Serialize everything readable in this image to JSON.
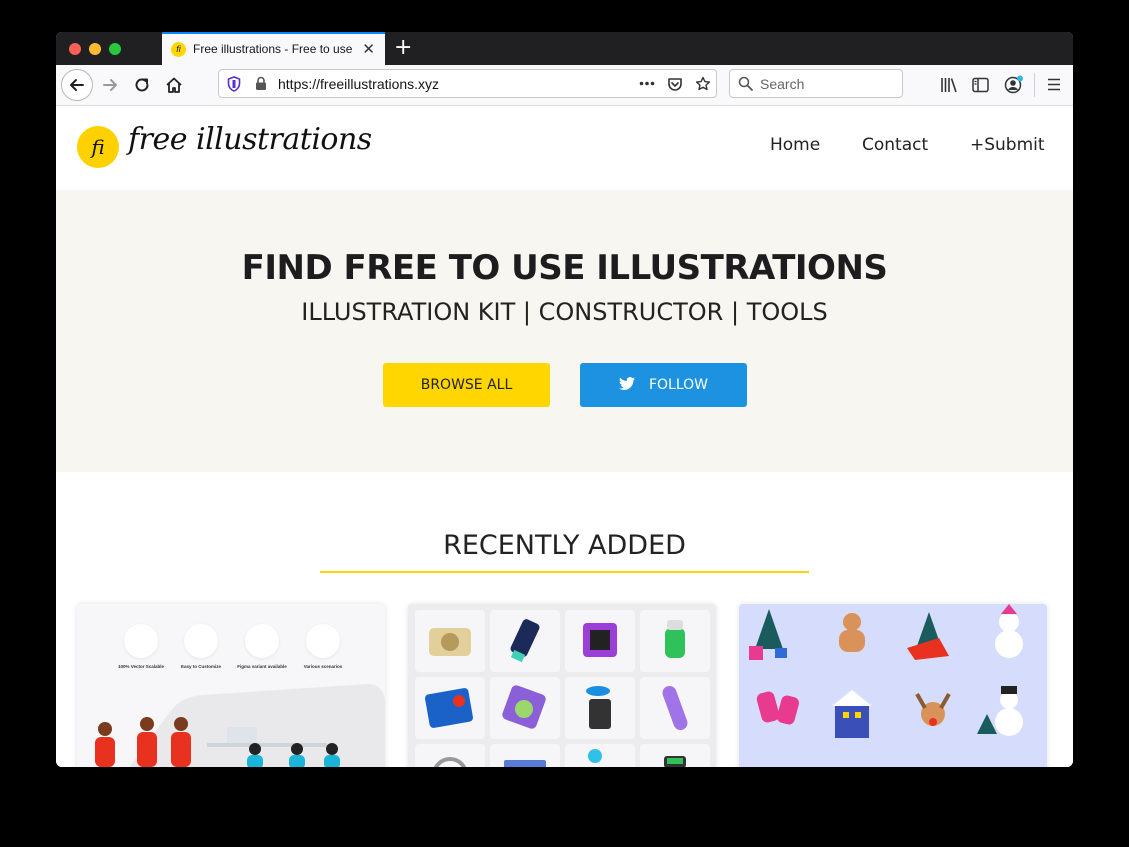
{
  "browser": {
    "tab_title": "Free illustrations - Free to use i",
    "url": "https://freeillustrations.xyz",
    "search_placeholder": "Search"
  },
  "site": {
    "logo_mark": "fi",
    "logo_text": "free illustrations",
    "nav": [
      {
        "label": "Home"
      },
      {
        "label": "Contact"
      },
      {
        "label": "+Submit"
      }
    ]
  },
  "hero": {
    "title": "FIND FREE TO USE ILLUSTRATIONS",
    "subtitle": "ILLUSTRATION KIT | CONSTRUCTOR | TOOLS",
    "browse_label": "BROWSE ALL",
    "follow_label": "FOLLOW"
  },
  "recent": {
    "title": "RECENTLY ADDED",
    "card1_features": [
      "100% Vector Scalable",
      "Easy to Customize",
      "Figma variant available",
      "Various scenarios"
    ]
  },
  "colors": {
    "accent": "#ffd600",
    "twitter": "#1d92e0",
    "hero_bg": "#f7f6f0"
  }
}
